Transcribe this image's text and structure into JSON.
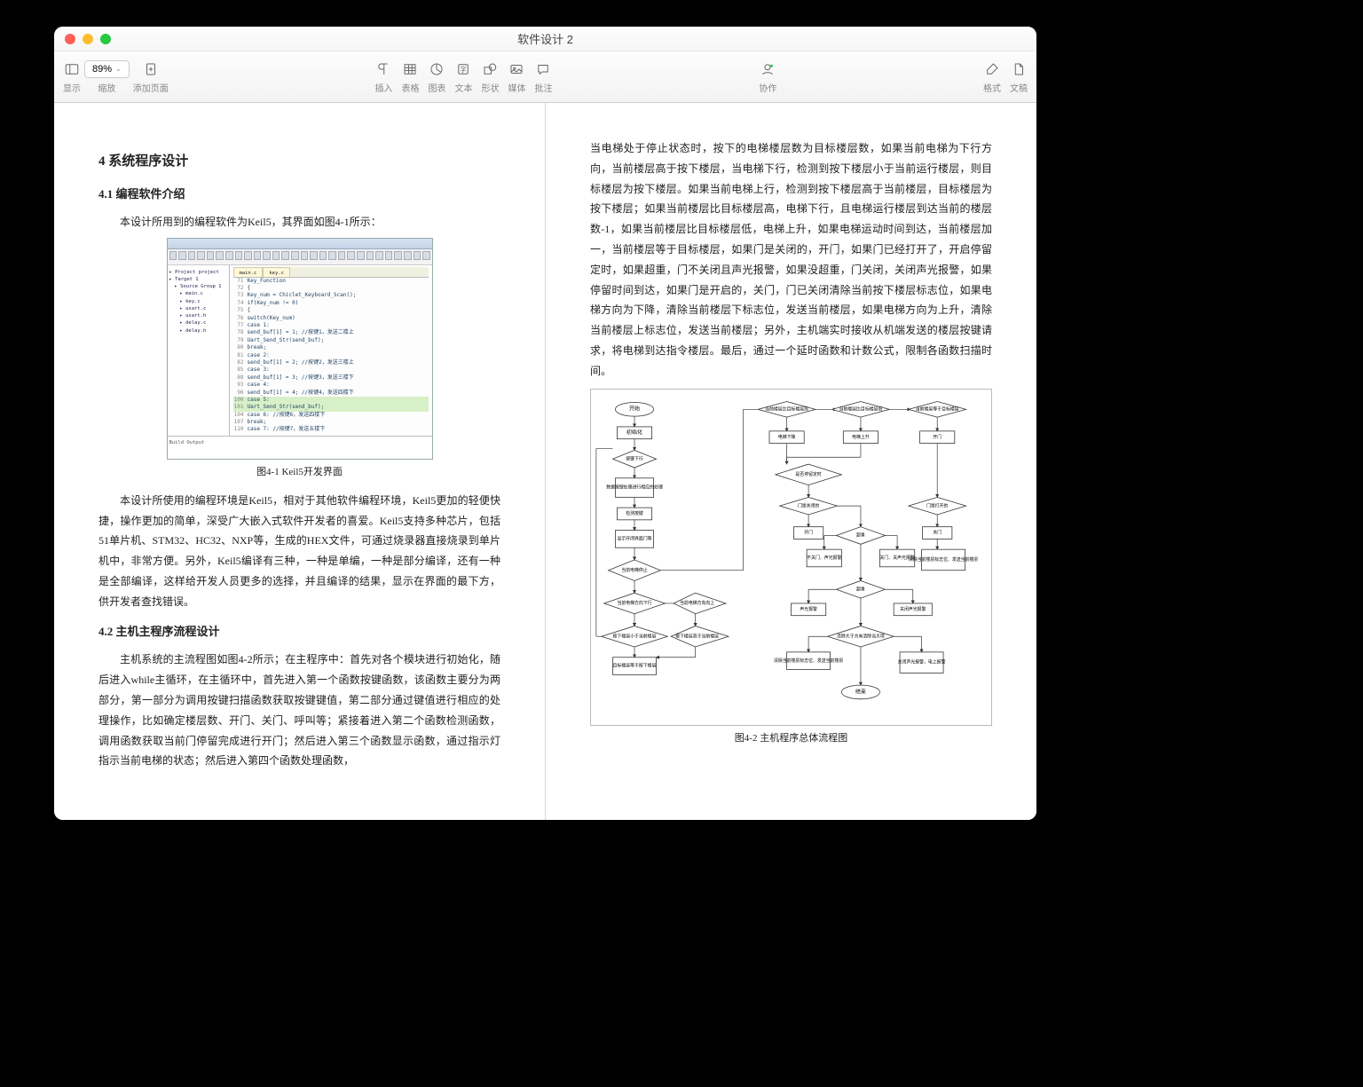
{
  "window": {
    "title": "软件设计 2"
  },
  "toolbar": {
    "view_label": "显示",
    "zoom_value": "89%",
    "zoom_label": "缩放",
    "add_page_label": "添加页面",
    "insert_label": "插入",
    "table_label": "表格",
    "chart_label": "图表",
    "text_label": "文本",
    "shape_label": "形状",
    "media_label": "媒体",
    "comment_label": "批注",
    "collab_label": "协作",
    "format_label": "格式",
    "document_label": "文稿"
  },
  "page_left": {
    "h2": "4 系统程序设计",
    "h3_1": "4.1 编程软件介绍",
    "p1": "本设计所用到的编程软件为Keil5，其界面如图4-1所示：",
    "fig1_caption": "图4-1 Keil5开发界面",
    "p2": "本设计所使用的编程环境是Keil5，相对于其他软件编程环境，Keil5更加的轻便快捷，操作更加的简单，深受广大嵌入式软件开发者的喜爱。Keil5支持多种芯片，包括51单片机、STM32、HC32、NXP等，生成的HEX文件，可通过烧录器直接烧录到单片机中，非常方便。另外，Keil5编译有三种，一种是单编，一种是部分编译，还有一种是全部编译，这样给开发人员更多的选择，并且编译的结果，显示在界面的最下方，供开发者查找错误。",
    "h3_2": "4.2 主机主程序流程设计",
    "p3": "主机系统的主流程图如图4-2所示；在主程序中：首先对各个模块进行初始化，随后进入while主循环，在主循环中，首先进入第一个函数按键函数，该函数主要分为两部分，第一部分为调用按键扫描函数获取按键键值，第二部分通过键值进行相应的处理操作，比如确定楼层数、开门、关门、呼叫等；紧接着进入第二个函数检测函数，调用函数获取当前门停留完成进行开门；然后进入第三个函数显示函数，通过指示灯指示当前电梯的状态；然后进入第四个函数处理函数，"
  },
  "page_right": {
    "p1": "当电梯处于停止状态时，按下的电梯楼层数为目标楼层数，如果当前电梯为下行方向，当前楼层高于按下楼层，当电梯下行，检测到按下楼层小于当前运行楼层，则目标楼层为按下楼层。如果当前电梯上行，检测到按下楼层高于当前楼层，目标楼层为按下楼层；如果当前楼层比目标楼层高，电梯下行，且电梯运行楼层到达当前的楼层数-1，如果当前楼层比目标楼层低，电梯上升，如果电梯运动时间到达，当前楼层加一，当前楼层等于目标楼层，如果门是关闭的，开门，如果门已经打开了，开启停留定时，如果超重，门不关闭且声光报警，如果没超重，门关闭，关闭声光报警，如果停留时间到达，如果门是开启的，关门，门已关闭清除当前按下楼层标志位，如果电梯方向为下降，清除当前楼层下标志位，发送当前楼层，如果电梯方向为上升，清除当前楼层上标志位，发送当前楼层；另外，主机端实时接收从机端发送的楼层按键请求，将电梯到达指令楼层。最后，通过一个延时函数和计数公式，限制各函数扫描时间。",
    "fig2_caption": "图4-2  主机程序总体流程图"
  },
  "keil": {
    "tree": [
      "Project project",
      "Target 1",
      " Source Group 1",
      "  main.c",
      "  key.c",
      "  usart.c",
      "  usart.h",
      "  delay.c",
      "  delay.h"
    ],
    "tabs": [
      "main.c",
      "key.c"
    ],
    "lines": [
      {
        "n": "71",
        "c": "Key_Function",
        "cls": ""
      },
      {
        "n": "72",
        "c": "{",
        "cls": ""
      },
      {
        "n": "73",
        "c": "  Key_num = Chiclet_Keyboard_Scan();",
        "cls": ""
      },
      {
        "n": "74",
        "c": "  if(Key_num != 0)",
        "cls": ""
      },
      {
        "n": "75",
        "c": "  {",
        "cls": ""
      },
      {
        "n": "76",
        "c": "    switch(Key_num)",
        "cls": ""
      },
      {
        "n": "77",
        "c": "    case 1:",
        "cls": "cm"
      },
      {
        "n": "78",
        "c": "      send_buf[1] = 1;    //按键1，发送二楼上",
        "cls": ""
      },
      {
        "n": "79",
        "c": "      Uart_Send_Str(send_buf);",
        "cls": ""
      },
      {
        "n": "80",
        "c": "    break;",
        "cls": ""
      },
      {
        "n": "81",
        "c": "    case 2:",
        "cls": "cm"
      },
      {
        "n": "82",
        "c": "      send_buf[1] = 2;    //按键2，发送三楼上",
        "cls": ""
      },
      {
        "n": "85",
        "c": "    case 3:",
        "cls": ""
      },
      {
        "n": "88",
        "c": "      send_buf[1] = 3;    //按键3，发送三楼下",
        "cls": ""
      },
      {
        "n": "93",
        "c": "    case 4:",
        "cls": ""
      },
      {
        "n": "96",
        "c": "      send_buf[1] = 4;    //按键4，发送四楼下",
        "cls": ""
      },
      {
        "n": "100",
        "c": "    case 5:",
        "cls": "hl"
      },
      {
        "n": "101",
        "c": "      Uart_Send_Str(send_buf);",
        "cls": "hl"
      },
      {
        "n": "104",
        "c": "    case 6:             //按键6，发送四楼下",
        "cls": ""
      },
      {
        "n": "107",
        "c": "    break;",
        "cls": ""
      },
      {
        "n": "110",
        "c": "    case 7:             //按键7，发送五楼下",
        "cls": ""
      }
    ],
    "output": "Build Output"
  },
  "flow": {
    "start": "开始",
    "init": "初始化",
    "keydown": "按键下行",
    "keyproc": "数据按键处理进行相应的处理",
    "detect": "检测按键",
    "dispopen": "显示开闭界面门等",
    "elev_stop": "当前电梯停止",
    "elev_dir_down": "当前电梯方向下行",
    "elev_dir_up": "当前电梯方向向上",
    "press_down": "按下楼层小于当前楼层",
    "press_up": "按下楼层高于当前楼层",
    "target_press": "目标楼层等于按下楼层",
    "cur_gt": "当前楼层比目标楼层高",
    "cur_lt": "当前楼层比目标楼层低",
    "cur_eq": "当前楼层等于目标楼层",
    "go_down": "电梯下降",
    "go_up": "电梯上升",
    "door_open": "开门",
    "reach_stop": "是否停留定时",
    "door_closed": "门是关闭的",
    "door_opened": "门是打开的",
    "open": "开门",
    "close": "关门",
    "overwt": "超重",
    "alarm": "声光报警",
    "noalarm": "关闭声光报警",
    "no_close": "不关门、声光报警",
    "do_close": "关门、关声光报警",
    "clear_dir": "清除当前楼层标志位、发送当前楼层",
    "stay": "结束",
    "clear_cur": "清除大于方向清除当大项",
    "send_cur": "关闭声光报警，电上报警"
  }
}
